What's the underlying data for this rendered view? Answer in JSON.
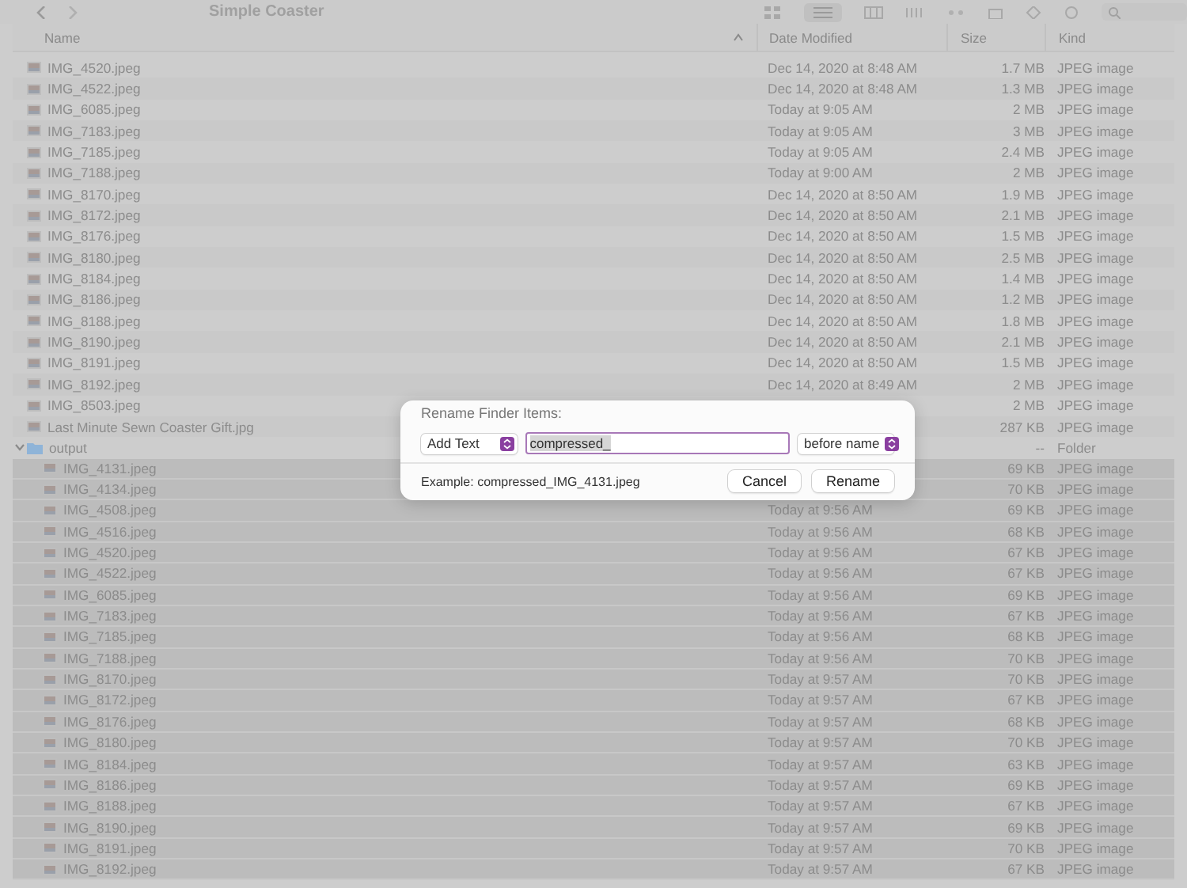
{
  "window": {
    "title": "Simple Coaster"
  },
  "columns": [
    {
      "label": "Name",
      "sorted": true
    },
    {
      "label": "Date Modified",
      "sorted": false
    },
    {
      "label": "Size",
      "sorted": false
    },
    {
      "label": "Kind",
      "sorted": false
    }
  ],
  "files": [
    {
      "kind": "image",
      "name": "IMG_4520.jpeg",
      "date": "Dec 14, 2020 at 8:48 AM",
      "size": "1.7 MB",
      "file_type": "JPEG image",
      "selected": false
    },
    {
      "kind": "image",
      "name": "IMG_4522.jpeg",
      "date": "Dec 14, 2020 at 8:48 AM",
      "size": "1.3 MB",
      "file_type": "JPEG image",
      "selected": false
    },
    {
      "kind": "image",
      "name": "IMG_6085.jpeg",
      "date": "Today at 9:05 AM",
      "size": "2 MB",
      "file_type": "JPEG image",
      "selected": false
    },
    {
      "kind": "image",
      "name": "IMG_7183.jpeg",
      "date": "Today at 9:05 AM",
      "size": "3 MB",
      "file_type": "JPEG image",
      "selected": false
    },
    {
      "kind": "image",
      "name": "IMG_7185.jpeg",
      "date": "Today at 9:05 AM",
      "size": "2.4 MB",
      "file_type": "JPEG image",
      "selected": false
    },
    {
      "kind": "image",
      "name": "IMG_7188.jpeg",
      "date": "Today at 9:00 AM",
      "size": "2 MB",
      "file_type": "JPEG image",
      "selected": false
    },
    {
      "kind": "image",
      "name": "IMG_8170.jpeg",
      "date": "Dec 14, 2020 at 8:50 AM",
      "size": "1.9 MB",
      "file_type": "JPEG image",
      "selected": false
    },
    {
      "kind": "image",
      "name": "IMG_8172.jpeg",
      "date": "Dec 14, 2020 at 8:50 AM",
      "size": "2.1 MB",
      "file_type": "JPEG image",
      "selected": false
    },
    {
      "kind": "image",
      "name": "IMG_8176.jpeg",
      "date": "Dec 14, 2020 at 8:50 AM",
      "size": "1.5 MB",
      "file_type": "JPEG image",
      "selected": false
    },
    {
      "kind": "image",
      "name": "IMG_8180.jpeg",
      "date": "Dec 14, 2020 at 8:50 AM",
      "size": "2.5 MB",
      "file_type": "JPEG image",
      "selected": false
    },
    {
      "kind": "image",
      "name": "IMG_8184.jpeg",
      "date": "Dec 14, 2020 at 8:50 AM",
      "size": "1.4 MB",
      "file_type": "JPEG image",
      "selected": false
    },
    {
      "kind": "image",
      "name": "IMG_8186.jpeg",
      "date": "Dec 14, 2020 at 8:50 AM",
      "size": "1.2 MB",
      "file_type": "JPEG image",
      "selected": false
    },
    {
      "kind": "image",
      "name": "IMG_8188.jpeg",
      "date": "Dec 14, 2020 at 8:50 AM",
      "size": "1.8 MB",
      "file_type": "JPEG image",
      "selected": false
    },
    {
      "kind": "image",
      "name": "IMG_8190.jpeg",
      "date": "Dec 14, 2020 at 8:50 AM",
      "size": "2.1 MB",
      "file_type": "JPEG image",
      "selected": false
    },
    {
      "kind": "image",
      "name": "IMG_8191.jpeg",
      "date": "Dec 14, 2020 at 8:50 AM",
      "size": "1.5 MB",
      "file_type": "JPEG image",
      "selected": false
    },
    {
      "kind": "image",
      "name": "IMG_8192.jpeg",
      "date": "Dec 14, 2020 at 8:49 AM",
      "size": "2 MB",
      "file_type": "JPEG image",
      "selected": false
    },
    {
      "kind": "image",
      "name": "IMG_8503.jpeg",
      "size": "2 MB",
      "file_type": "JPEG image",
      "selected": false
    },
    {
      "kind": "image",
      "name": "Last Minute Sewn Coaster Gift.jpg",
      "size": "287 KB",
      "file_type": "JPEG image",
      "selected": false
    },
    {
      "kind": "folder",
      "name": "output",
      "size": "--",
      "file_type": "Folder",
      "selected": false,
      "expanded": true,
      "children": [
        {
          "kind": "image",
          "name": "IMG_4131.jpeg",
          "size": "69 KB",
          "file_type": "JPEG image",
          "selected": true
        },
        {
          "kind": "image",
          "name": "IMG_4134.jpeg",
          "size": "70 KB",
          "file_type": "JPEG image",
          "selected": true
        },
        {
          "kind": "image",
          "name": "IMG_4508.jpeg",
          "date": "Today at 9:56 AM",
          "size": "69 KB",
          "file_type": "JPEG image",
          "selected": true
        },
        {
          "kind": "image",
          "name": "IMG_4516.jpeg",
          "date": "Today at 9:56 AM",
          "size": "68 KB",
          "file_type": "JPEG image",
          "selected": true
        },
        {
          "kind": "image",
          "name": "IMG_4520.jpeg",
          "date": "Today at 9:56 AM",
          "size": "67 KB",
          "file_type": "JPEG image",
          "selected": true
        },
        {
          "kind": "image",
          "name": "IMG_4522.jpeg",
          "date": "Today at 9:56 AM",
          "size": "67 KB",
          "file_type": "JPEG image",
          "selected": true
        },
        {
          "kind": "image",
          "name": "IMG_6085.jpeg",
          "date": "Today at 9:56 AM",
          "size": "69 KB",
          "file_type": "JPEG image",
          "selected": true
        },
        {
          "kind": "image",
          "name": "IMG_7183.jpeg",
          "date": "Today at 9:56 AM",
          "size": "67 KB",
          "file_type": "JPEG image",
          "selected": true
        },
        {
          "kind": "image",
          "name": "IMG_7185.jpeg",
          "date": "Today at 9:56 AM",
          "size": "68 KB",
          "file_type": "JPEG image",
          "selected": true
        },
        {
          "kind": "image",
          "name": "IMG_7188.jpeg",
          "date": "Today at 9:56 AM",
          "size": "70 KB",
          "file_type": "JPEG image",
          "selected": true
        },
        {
          "kind": "image",
          "name": "IMG_8170.jpeg",
          "date": "Today at 9:57 AM",
          "size": "70 KB",
          "file_type": "JPEG image",
          "selected": true
        },
        {
          "kind": "image",
          "name": "IMG_8172.jpeg",
          "date": "Today at 9:57 AM",
          "size": "67 KB",
          "file_type": "JPEG image",
          "selected": true
        },
        {
          "kind": "image",
          "name": "IMG_8176.jpeg",
          "date": "Today at 9:57 AM",
          "size": "68 KB",
          "file_type": "JPEG image",
          "selected": true
        },
        {
          "kind": "image",
          "name": "IMG_8180.jpeg",
          "date": "Today at 9:57 AM",
          "size": "70 KB",
          "file_type": "JPEG image",
          "selected": true
        },
        {
          "kind": "image",
          "name": "IMG_8184.jpeg",
          "date": "Today at 9:57 AM",
          "size": "63 KB",
          "file_type": "JPEG image",
          "selected": true
        },
        {
          "kind": "image",
          "name": "IMG_8186.jpeg",
          "date": "Today at 9:57 AM",
          "size": "69 KB",
          "file_type": "JPEG image",
          "selected": true
        },
        {
          "kind": "image",
          "name": "IMG_8188.jpeg",
          "date": "Today at 9:57 AM",
          "size": "67 KB",
          "file_type": "JPEG image",
          "selected": true
        },
        {
          "kind": "image",
          "name": "IMG_8190.jpeg",
          "date": "Today at 9:57 AM",
          "size": "69 KB",
          "file_type": "JPEG image",
          "selected": true
        },
        {
          "kind": "image",
          "name": "IMG_8191.jpeg",
          "date": "Today at 9:57 AM",
          "size": "70 KB",
          "file_type": "JPEG image",
          "selected": true
        },
        {
          "kind": "image",
          "name": "IMG_8192.jpeg",
          "date": "Today at 9:57 AM",
          "size": "67 KB",
          "file_type": "JPEG image",
          "selected": true
        }
      ]
    }
  ],
  "dialog": {
    "title": "Rename Finder Items:",
    "mode": "Add Text",
    "text": "compressed_",
    "text_selected": true,
    "position": "before name",
    "example": "Example: compressed_IMG_4131.jpeg",
    "buttons": [
      {
        "label": "Cancel"
      },
      {
        "label": "Rename"
      }
    ]
  }
}
